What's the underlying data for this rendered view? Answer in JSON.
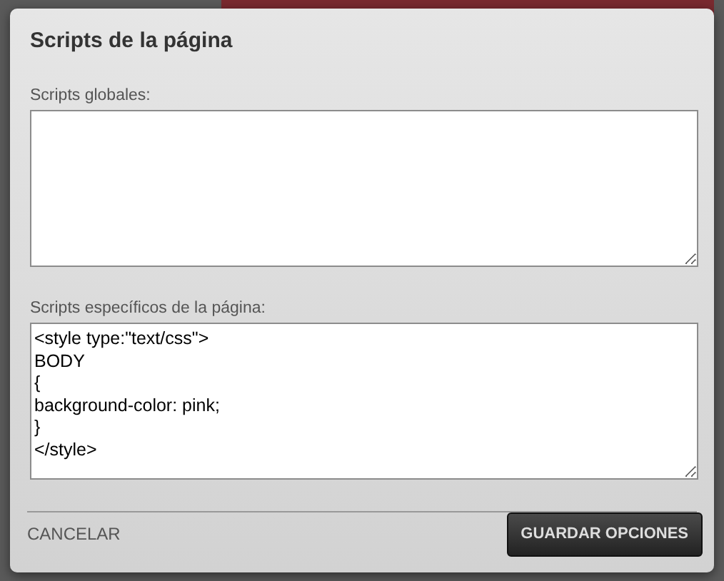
{
  "dialog": {
    "title": "Scripts de la página",
    "fields": [
      {
        "label": "Scripts globales:"
      },
      {
        "label": "Scripts específicos de la página:",
        "value": "<style type:\"text/css\">\nBODY\n{\nbackground-color: pink;\n}\n</style>"
      }
    ],
    "cancel": "CANCELAR",
    "save": "GUARDAR OPCIONES"
  }
}
